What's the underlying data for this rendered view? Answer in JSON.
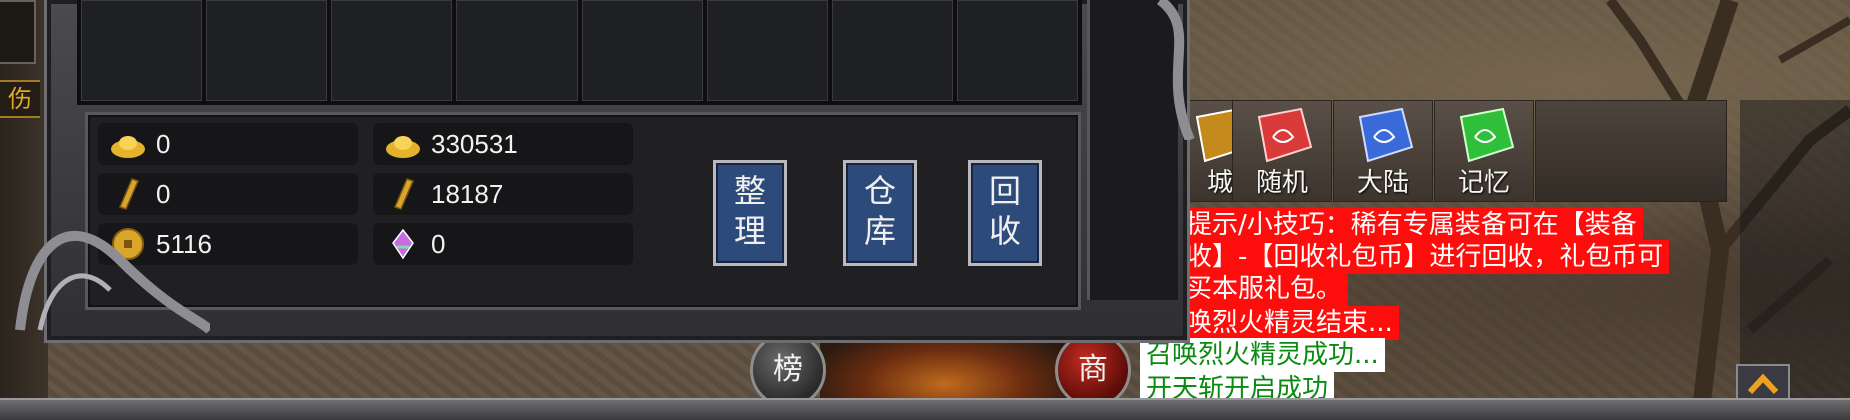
{
  "left_panel": {
    "label": "伤害"
  },
  "inventory": {
    "slots": 8,
    "currency": [
      {
        "icon": "gold-ingot-icon",
        "value": "0"
      },
      {
        "icon": "gold-ingot-icon",
        "value": "330531"
      },
      {
        "icon": "gold-scroll-icon",
        "value": "0"
      },
      {
        "icon": "gold-scroll-icon",
        "value": "18187"
      },
      {
        "icon": "gold-coin-icon",
        "value": "5116"
      },
      {
        "icon": "crystal-icon",
        "value": "0"
      }
    ],
    "buttons": [
      {
        "line1": "整",
        "line2": "理"
      },
      {
        "line1": "仓",
        "line2": "库"
      },
      {
        "line1": "回",
        "line2": "收"
      }
    ]
  },
  "teleports": [
    {
      "label": "城",
      "color": "#c58a1c"
    },
    {
      "label": "随机",
      "color": "#d93a3a"
    },
    {
      "label": "大陆",
      "color": "#3a6ad9"
    },
    {
      "label": "记忆",
      "color": "#2fbf3a"
    }
  ],
  "chat": [
    {
      "text": "提示/小技巧：稀有专属装备可在【装备",
      "style": "red"
    },
    {
      "text": "收】-【回收礼包币】进行回收，礼包币可",
      "style": "red"
    },
    {
      "text": "买本服礼包。",
      "style": "red"
    },
    {
      "text": "唤烈火精灵结束...",
      "style": "red"
    },
    {
      "text": "召唤烈火精灵成功...",
      "style": "green"
    },
    {
      "text": "开天斩开启成功",
      "style": "green"
    }
  ],
  "round_buttons": [
    {
      "label": "榜"
    },
    {
      "label": "商"
    }
  ]
}
